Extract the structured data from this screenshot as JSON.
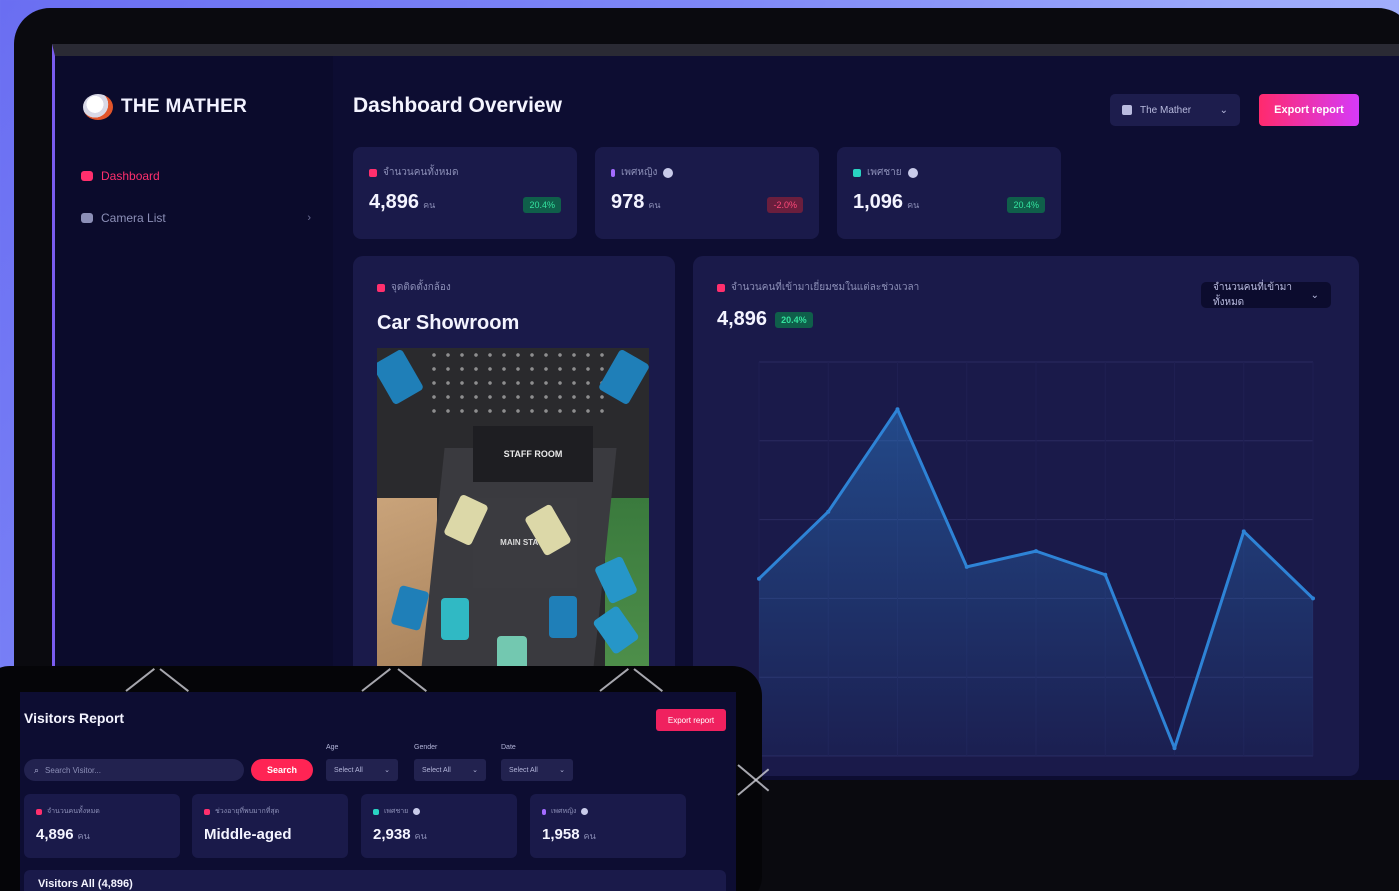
{
  "brand": {
    "name": "THE MATHER"
  },
  "sidebar": {
    "items": [
      {
        "label": "Dashboard",
        "active": true,
        "icon": "home-icon"
      },
      {
        "label": "Camera List",
        "active": false,
        "icon": "camera-icon"
      }
    ]
  },
  "header": {
    "title": "Dashboard Overview",
    "location_select": "The Mather",
    "export_label": "Export report"
  },
  "kpis": [
    {
      "label": "จำนวนคนทั้งหมด",
      "value": "4,896",
      "unit": "คน",
      "badge": "20.4%",
      "trend": "up",
      "color": "#ff2f6d"
    },
    {
      "label": "เพศหญิง",
      "value": "978",
      "unit": "คน",
      "badge": "-2.0%",
      "trend": "down",
      "color": "#a36bff"
    },
    {
      "label": "เพศชาย",
      "value": "1,096",
      "unit": "คน",
      "badge": "20.4%",
      "trend": "up",
      "color": "#29d3c2"
    }
  ],
  "showroom": {
    "label": "จุดติดตั้งกล้อง",
    "title": "Car Showroom",
    "staff_room": "STAFF ROOM",
    "main_stage": "MAIN STAGE"
  },
  "visitors_chart": {
    "label": "จำนวนคนที่เข้ามาเยี่ยมชมในแต่ละช่วงเวลา",
    "value": "4,896",
    "badge": "20.4%",
    "select": "จำนวนคนที่เข้ามาทั้งหมด"
  },
  "chart_data": {
    "type": "area",
    "values": [
      45,
      62,
      88,
      48,
      52,
      46,
      2,
      57,
      40
    ],
    "ylim": [
      0,
      100
    ],
    "grid": true,
    "color": "#2e83d6"
  },
  "report": {
    "title": "Visitors Report",
    "export_label": "Export report",
    "search_placeholder": "Search Visitor...",
    "search_button": "Search",
    "filters": [
      {
        "label": "Age",
        "value": "Select All"
      },
      {
        "label": "Gender",
        "value": "Select All"
      },
      {
        "label": "Date",
        "value": "Select All"
      }
    ],
    "kpis": [
      {
        "label": "จำนวนคนทั้งหมด",
        "value": "4,896",
        "unit": "คน",
        "color": "#ff2f6d"
      },
      {
        "label": "ช่วงอายุที่พบมากที่สุด",
        "value": "Middle-aged",
        "unit": "",
        "color": "#ff2f6d"
      },
      {
        "label": "เพศชาย",
        "value": "2,938",
        "unit": "คน",
        "color": "#29d3c2"
      },
      {
        "label": "เพศหญิง",
        "value": "1,958",
        "unit": "คน",
        "color": "#a36bff"
      }
    ],
    "all_visitors": "Visitors All (4,896)"
  }
}
